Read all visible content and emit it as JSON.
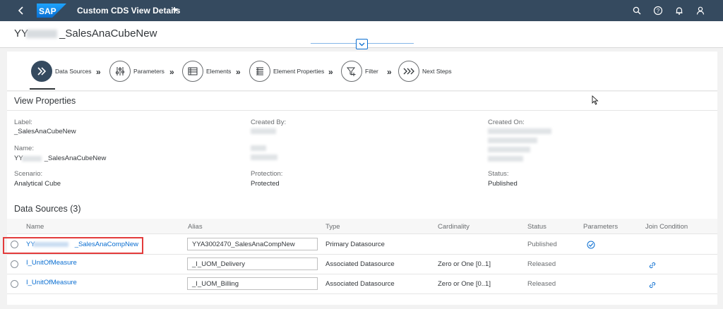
{
  "shell": {
    "title": "Custom CDS View Details",
    "logo_text": "SAP",
    "icons": [
      "back-icon",
      "search-icon",
      "help-icon",
      "bell-icon",
      "user-icon"
    ]
  },
  "header": {
    "object_title": "YY____70_SalesAnaCubeNew",
    "title_prefix": "YY",
    "title_suffix": "_SalesAnaCubeNew"
  },
  "wizard": {
    "steps": [
      {
        "label": "Data Sources",
        "icon": "data-sources-icon",
        "active": true
      },
      {
        "label": "Parameters",
        "icon": "parameters-icon",
        "active": false
      },
      {
        "label": "Elements",
        "icon": "elements-icon",
        "active": false
      },
      {
        "label": "Element Properties",
        "icon": "element-properties-icon",
        "active": false
      },
      {
        "label": "Filter",
        "icon": "filter-icon",
        "active": false
      },
      {
        "label": "Next Steps",
        "icon": "next-steps-icon",
        "active": false
      }
    ],
    "separator": "»"
  },
  "view_properties": {
    "title": "View Properties",
    "label_label": "Label:",
    "label_value": "_SalesAnaCubeNew",
    "name_label": "Name:",
    "name_prefix": "YY",
    "name_suffix": "_SalesAnaCubeNew",
    "scenario_label": "Scenario:",
    "scenario_value": "Analytical Cube",
    "created_by_label": "Created By:",
    "protection_label": "Protection:",
    "protection_value": "Protected",
    "created_on_label": "Created On:",
    "status_label": "Status:",
    "status_value": "Published"
  },
  "data_sources": {
    "title": "Data Sources (3)",
    "columns": [
      "Name",
      "Alias",
      "Type",
      "Cardinality",
      "Status",
      "Parameters",
      "Join Condition"
    ],
    "rows": [
      {
        "name_prefix": "YY",
        "name_suffix": "_SalesAnaCompNew",
        "alias": "YYA3002470_SalesAnaCompNew",
        "type": "Primary Datasource",
        "cardinality": "",
        "status": "Published",
        "parameters": "check-icon",
        "join": ""
      },
      {
        "name": "I_UnitOfMeasure",
        "alias": "_I_UOM_Delivery",
        "type": "Associated Datasource",
        "cardinality": "Zero or One [0..1]",
        "status": "Released",
        "parameters": "",
        "join": "link-icon"
      },
      {
        "name": "I_UnitOfMeasure",
        "alias": "_I_UOM_Billing",
        "type": "Associated Datasource",
        "cardinality": "Zero or One [0..1]",
        "status": "Released",
        "parameters": "",
        "join": "link-icon"
      }
    ]
  },
  "colors": {
    "shell": "#354a5f",
    "link": "#0a6ed1",
    "highlight": "#e33b3b"
  }
}
